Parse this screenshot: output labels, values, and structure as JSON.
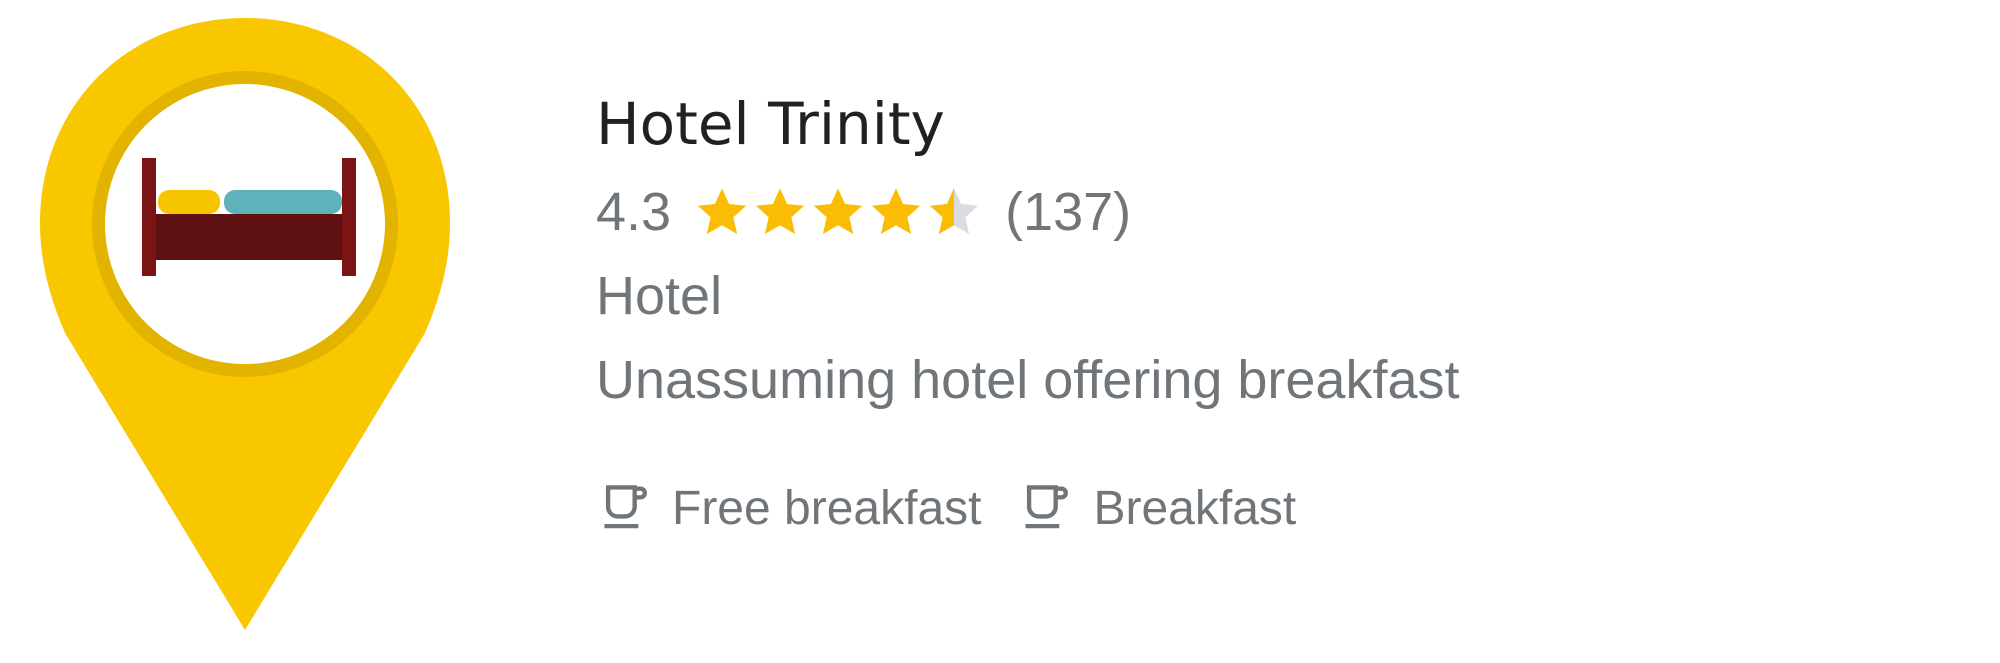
{
  "place": {
    "name": "Hotel Trinity",
    "rating": "4.3",
    "rating_value": 4.3,
    "max_stars": 5,
    "review_count": "(137)",
    "category": "Hotel",
    "description": "Unassuming hotel offering breakfast"
  },
  "amenities": [
    {
      "label": "Free breakfast",
      "icon": "coffee-cup-icon"
    },
    {
      "label": "Breakfast",
      "icon": "coffee-cup-icon"
    }
  ],
  "marker": {
    "icon": "bed-icon",
    "pin_color": "#f9c700",
    "ring_color": "#e2b400"
  },
  "colors": {
    "star_filled": "#fbbc04",
    "star_empty": "#dadce0",
    "text_primary": "#202124",
    "text_secondary": "#70757a"
  }
}
